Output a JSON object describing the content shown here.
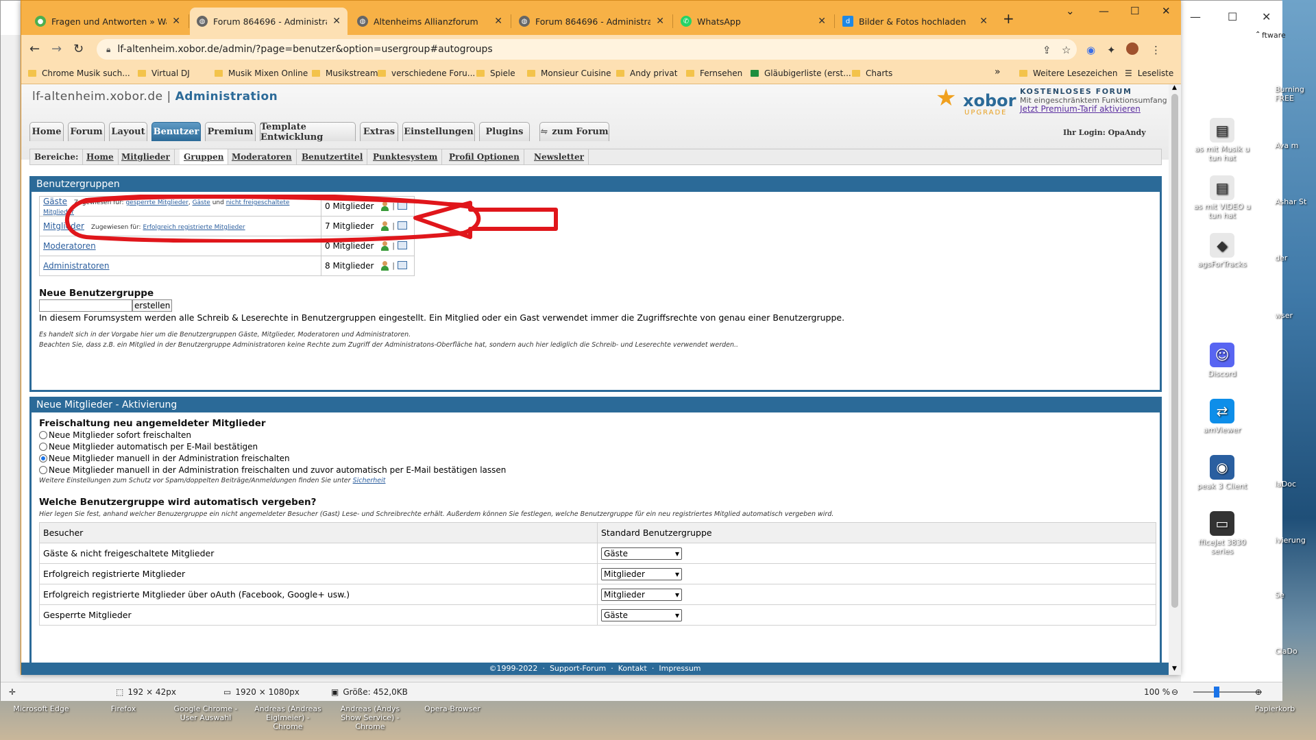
{
  "desktop": {
    "right_icons": [
      {
        "label": "as mit Musik u tun hat",
        "icon": "document-icon"
      },
      {
        "label": "as mit VIDEO u tun hat",
        "icon": "document-icon"
      },
      {
        "label": "agsForTracks",
        "icon": "tag-icon"
      },
      {
        "label": "Discord",
        "icon": "discord-icon"
      },
      {
        "label": "amViewer",
        "icon": "teamviewer-icon"
      },
      {
        "label": "peak 3 Client",
        "icon": "teamspeak-icon"
      },
      {
        "label": "fficeJet 3830 series",
        "icon": "printer-icon"
      }
    ],
    "far_right_labels": [
      "Burning FREE",
      "Ava m",
      "Ashar St",
      "der",
      "wser",
      "laDoc",
      "Se",
      "ClaDo",
      "ivierung"
    ],
    "edge_fragments": [
      "ftware",
      "Papierkorb"
    ]
  },
  "viewer": {
    "status": {
      "selection": "192 × 42px",
      "dimensions": "1920 × 1080px",
      "size": "Größe: 452,0KB",
      "zoom": "100 %"
    }
  },
  "taskbar": {
    "items": [
      "Microsoft Edge",
      "Firefox",
      "Google Chrome - User Auswahl",
      "Andreas (Andreas Eiglmeier) - Chrome",
      "Andreas (Andys Show Service) - Chrome",
      "Opera-Browser"
    ]
  },
  "browser": {
    "tabs": [
      {
        "title": "Fragen und Antworten » Warum",
        "color": "#4caf50",
        "active": false
      },
      {
        "title": "Forum 864696 - Administration",
        "color": "#555555",
        "active": true
      },
      {
        "title": "Altenheims Allianzforum",
        "color": "#555555",
        "active": false
      },
      {
        "title": "Forum 864696 - Administration",
        "color": "#555555",
        "active": false
      },
      {
        "title": "WhatsApp",
        "color": "#25d366",
        "active": false
      },
      {
        "title": "Bilder & Fotos hochladen",
        "color": "#1e88e5",
        "active": false
      }
    ],
    "url": "lf-altenheim.xobor.de/admin/?page=benutzer&option=usergroup#autogroups",
    "bookmarks": [
      "Chrome Musik such...",
      "Virtual DJ",
      "Musik Mixen Online",
      "Musikstream",
      "verschiedene Foru...",
      "Spiele",
      "Monsieur Cuisine",
      "Andy privat",
      "Fernsehen",
      "Gläubigerliste (erst...",
      "Charts"
    ],
    "bookmarks_more": "»",
    "other_bookmarks": "Weitere Lesezeichen",
    "reading_list": "Leseliste"
  },
  "page": {
    "site_name": "lf-altenheim.xobor.de",
    "site_sep": "|",
    "admin_label": "Administration",
    "logo": {
      "name": "xobor",
      "sub": "UPGRADE"
    },
    "promo": {
      "heading": "KOSTENLOSES FORUM",
      "line": "Mit eingeschränktem Funktionsumfang",
      "link": "Jetzt Premium-Tarif aktivieren"
    },
    "nav_tabs": [
      "Home",
      "Forum",
      "Layout",
      "Benutzer",
      "Premium",
      "Template Entwicklung",
      "Extras",
      "Einstellungen",
      "Plugins"
    ],
    "to_forum": "zum Forum",
    "login": "Ihr Login: OpaAndy",
    "subnav_label": "Bereiche:",
    "subnav": [
      "Home",
      "Mitglieder",
      "Gruppen",
      "Moderatoren",
      "Benutzertitel",
      "Punktesystem",
      "Profil Optionen",
      "Newsletter"
    ],
    "groups_panel": {
      "title": "Benutzergruppen",
      "rows": [
        {
          "name": "Gäste",
          "assigned_prefix": "Zugewiesen für:",
          "assigned": [
            "gesperrte Mitglieder",
            "Gäste",
            "nicht freigeschaltete Mitglieder"
          ],
          "and": "und",
          "members": "0 Mitglieder"
        },
        {
          "name": "Mitglieder",
          "assigned_prefix": "Zugewiesen für:",
          "assigned": [
            "Erfolgreich registrierte Mitglieder"
          ],
          "members": "7 Mitglieder"
        },
        {
          "name": "Moderatoren",
          "members": "0 Mitglieder"
        },
        {
          "name": "Administratoren",
          "members": "8 Mitglieder"
        }
      ],
      "new_group_label": "Neue Benutzergruppe",
      "create_button": "erstellen",
      "info": "In diesem Forumsystem werden alle Schreib & Leserechte in Benutzergruppen eingestellt. Ein Mitglied oder ein Gast verwendet immer die Zugriffsrechte von genau einer Benutzergruppe.",
      "note1": "Es handelt sich in der Vorgabe hier um die Benutzergruppen Gäste, Mitglieder, Moderatoren und Administratoren.",
      "note2": "Beachten Sie, dass z.B. ein Mitglied in der Benutzergruppe Administratoren keine Rechte zum Zugriff der Administratons-Oberfläche hat, sondern auch hier lediglich die Schreib- und Leserechte verwendet werden.."
    },
    "activation_panel": {
      "title": "Neue Mitglieder - Aktivierung",
      "heading": "Freischaltung neu angemeldeter Mitglieder",
      "options": [
        {
          "label": "Neue Mitglieder sofort freischalten",
          "checked": false
        },
        {
          "label": "Neue Mitglieder automatisch per E-Mail bestätigen",
          "checked": false
        },
        {
          "label": "Neue Mitglieder manuell in der Administration freischalten",
          "checked": true
        },
        {
          "label": "Neue Mitglieder manuell in der Administration freischalten und zuvor automatisch per E-Mail bestätigen lassen",
          "checked": false
        }
      ],
      "spam_note": "Weitere Einstellungen zum Schutz vor Spam/doppelten Beiträge/Anmeldungen finden Sie unter",
      "spam_link": "Sicherheit",
      "auto_heading": "Welche Benutzergruppe wird automatisch vergeben?",
      "auto_note": "Hier legen Sie fest, anhand welcher Benuzergruppe ein nicht angemeldeter Besucher (Gast) Lese- und Schreibrechte erhält. Außerdem können Sie festlegen, welche Benutzergruppe für ein neu registriertes Mitglied automatisch vergeben wird.",
      "col_visitor": "Besucher",
      "col_group": "Standard Benutzergruppe",
      "rows": [
        {
          "visitor": "Gäste & nicht freigeschaltete Mitglieder",
          "group": "Gäste"
        },
        {
          "visitor": "Erfolgreich registrierte Mitglieder",
          "group": "Mitglieder"
        },
        {
          "visitor": "Erfolgreich registrierte Mitglieder über oAuth (Facebook, Google+ usw.)",
          "group": "Mitglieder"
        },
        {
          "visitor": "Gesperrte Mitglieder",
          "group": "Gäste"
        }
      ]
    },
    "footer": {
      "copyright": "©1999-2022",
      "links": [
        "Support-Forum",
        "Kontakt",
        "Impressum"
      ],
      "dot": "·"
    }
  },
  "colors": {
    "accent": "#2b6a98",
    "tabstrip": "#f7b146",
    "annotation": "#e0161b"
  }
}
